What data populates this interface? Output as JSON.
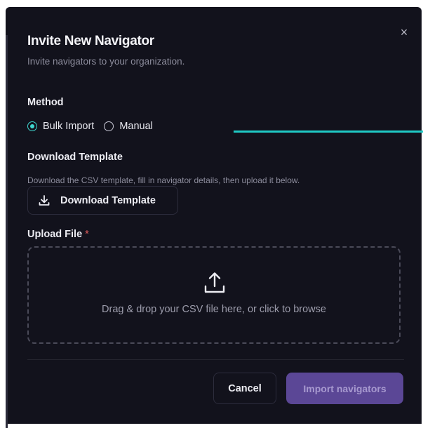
{
  "modal": {
    "title": "Invite New Navigator",
    "subtitle": "Invite navigators to your organization.",
    "close_icon": "close-icon"
  },
  "method": {
    "label": "Method",
    "options": [
      {
        "label": "Bulk Import",
        "selected": true
      },
      {
        "label": "Manual",
        "selected": false
      }
    ],
    "accent_color": "#3fd6cf"
  },
  "download_template": {
    "label": "Download Template",
    "description": "Download the CSV template, fill in navigator details, then upload it below.",
    "button_label": "Download Template",
    "icon": "download-icon"
  },
  "upload": {
    "label": "Upload File",
    "required_marker": "*",
    "dropzone_text": "Drag & drop your CSV file here, or click to browse",
    "icon": "upload-icon"
  },
  "footer": {
    "cancel_label": "Cancel",
    "import_label": "Import navigators"
  },
  "colors": {
    "background": "#12121c",
    "accent_line": "#1fc9c4",
    "primary_button": "#5b4796"
  }
}
